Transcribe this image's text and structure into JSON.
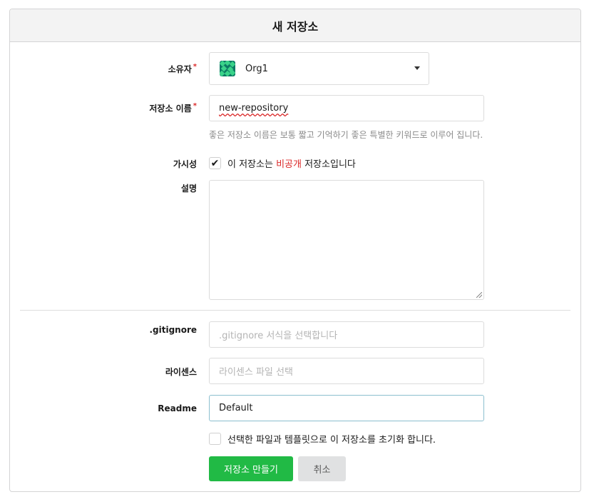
{
  "header": {
    "title": "새 저장소"
  },
  "owner": {
    "label": "소유자",
    "required_mark": "*",
    "value": "Org1",
    "avatar_icon": "org-avatar-icon"
  },
  "repo_name": {
    "label": "저장소 이름",
    "required_mark": "*",
    "value": "new-repository",
    "help": "좋은 저장소 이름은 보통 짧고 기억하기 좋은 특별한 키워드로 이루어 집니다."
  },
  "visibility": {
    "label": "가시성",
    "checked": true,
    "text_before": "이 저장소는 ",
    "text_private": "비공개",
    "text_after": " 저장소입니다"
  },
  "description": {
    "label": "설명",
    "value": ""
  },
  "gitignore": {
    "label": ".gitignore",
    "placeholder": ".gitignore 서식을 선택합니다"
  },
  "license": {
    "label": "라이센스",
    "placeholder": "라이센스 파일 선택"
  },
  "readme": {
    "label": "Readme",
    "value": "Default"
  },
  "auto_init": {
    "checked": false,
    "text": "선택한 파일과 템플릿으로 이 저장소를 초기화 합니다."
  },
  "actions": {
    "create_label": "저장소 만들기",
    "cancel_label": "취소"
  },
  "colors": {
    "primary": "#21ba45",
    "required": "#db2828",
    "private_text": "#db2828",
    "header_bg": "#f3f3f3"
  }
}
